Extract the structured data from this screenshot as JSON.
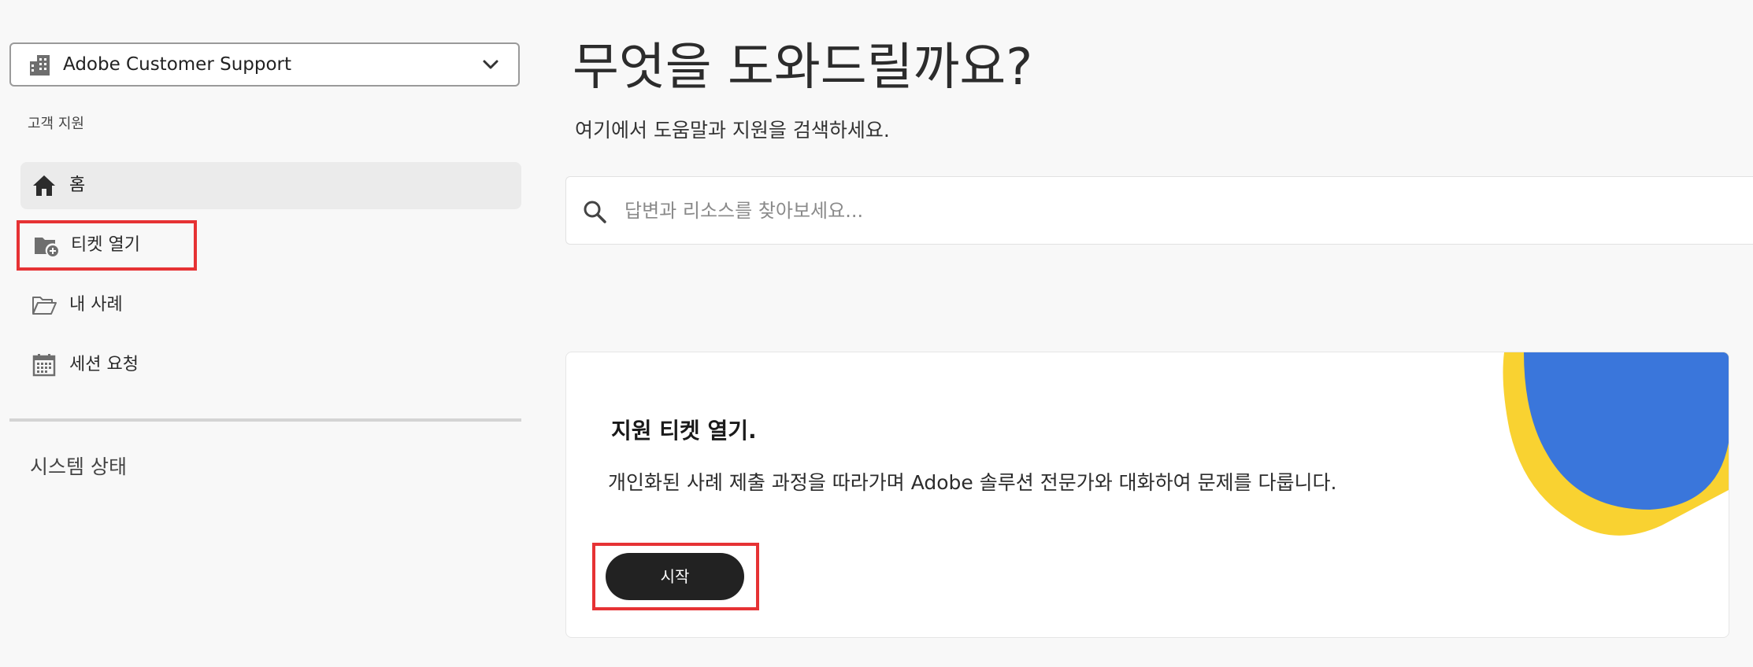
{
  "sidebar": {
    "org_selector": {
      "label": "Adobe Customer Support",
      "icon": "building-icon"
    },
    "section_label": "고객 지원",
    "nav_items": [
      {
        "label": "홈",
        "icon": "home-icon",
        "active": true
      },
      {
        "label": "티켓 열기",
        "icon": "folder-add-icon",
        "active": false
      },
      {
        "label": "내 사례",
        "icon": "folder-open-icon",
        "active": false
      },
      {
        "label": "세션 요청",
        "icon": "calendar-icon",
        "active": false
      }
    ],
    "system_status": "시스템 상태"
  },
  "main": {
    "title": "무엇을 도와드릴까요?",
    "subtitle": "여기에서 도움말과 지원을 검색하세요.",
    "search": {
      "placeholder": "답변과 리소스를 찾아보세요...",
      "value": ""
    },
    "card": {
      "title": "지원 티켓 열기.",
      "description": "개인화된 사례 제출 과정을 따라가며 Adobe 솔루션 전문가와 대화하여 문제를 다룹니다.",
      "button_label": "시작"
    }
  },
  "colors": {
    "highlight": "#e63234",
    "button_bg": "#222222",
    "deco_blue": "#3a76db",
    "deco_yellow": "#f9d231",
    "active_nav_bg": "#ebebeb"
  }
}
